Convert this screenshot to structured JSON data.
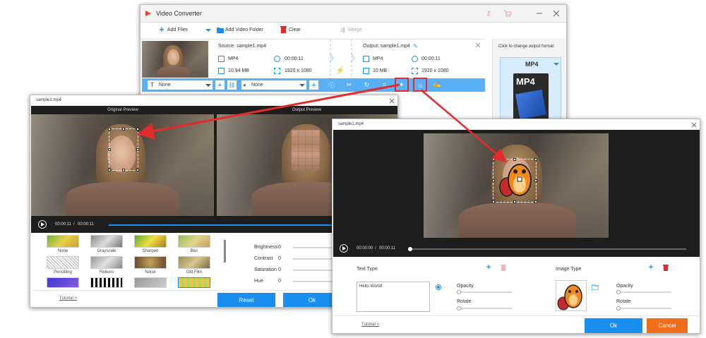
{
  "main_window": {
    "title": "Video Converter",
    "toolbar": {
      "add_files": "Add Files",
      "add_folder": "Add Video Folder",
      "clear": "Clear",
      "merge": "Merge"
    },
    "source": {
      "label": "Source: sample1.mp4",
      "format": "MP4",
      "duration": "00:00:11",
      "size": "10.94 MB",
      "resolution": "1920 x 1080"
    },
    "output": {
      "label": "Output: sample1.mp4",
      "format": "MP4",
      "duration": "00:00:11",
      "size": "10 MB",
      "resolution": "1920 x 1080"
    },
    "subtitle_select": "None",
    "audio_select": "None",
    "format_panel": {
      "hint": "Click to change output format:",
      "format": "MP4",
      "thumb_text": "MP4"
    }
  },
  "effects_window": {
    "title": "sample1.mp4",
    "original_preview": "Original Preview",
    "output_preview": "Output Preview",
    "time_current": "00:00:11",
    "time_sep": "/",
    "time_total": "00:00:11",
    "filters": [
      {
        "label": "None"
      },
      {
        "label": "Grayscale"
      },
      {
        "label": "Sharpen"
      },
      {
        "label": "Blur"
      },
      {
        "label": "Pencilling"
      },
      {
        "label": "Relievo"
      },
      {
        "label": "Noise"
      },
      {
        "label": "Old Film"
      }
    ],
    "adjust": [
      {
        "label": "Brightness",
        "value": "0"
      },
      {
        "label": "Contrast",
        "value": "0"
      },
      {
        "label": "Saturation",
        "value": "0"
      },
      {
        "label": "Hue",
        "value": "0"
      }
    ],
    "tutorial": "Tutorial >",
    "reset": "Reset",
    "ok": "Ok"
  },
  "watermark_window": {
    "title": "sample1.mp4",
    "time_current": "00:00:00",
    "time_sep": "/",
    "time_total": "00:00:11",
    "text_type": "Text Type",
    "text_value": "Hello World!",
    "opacity": "Opacity",
    "rotate": "Rotate",
    "image_type": "Image Type",
    "image_opacity": "Opacity",
    "image_rotate": "Rotate",
    "tutorial": "Tutorial >",
    "ok": "Ok",
    "cancel": "Cancel"
  },
  "colors": {
    "accent_blue": "#1a8ff0",
    "cancel_orange": "#f06e1a",
    "highlight_red": "#e22b2b"
  }
}
